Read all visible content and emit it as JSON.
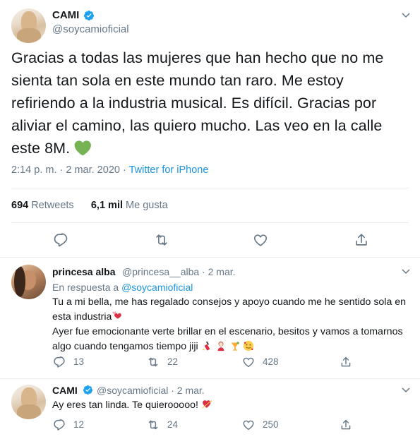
{
  "main_tweet": {
    "name": "CAMI",
    "handle": "@soycamioficial",
    "text": "Gracias a todas las mujeres que han hecho que no me sienta tan sola en este mundo tan raro. Me estoy refiriendo a la industria musical. Es difícil. Gracias por aliviar el camino, las quiero mucho. Las veo en la calle este 8M.",
    "timestamp": "2:14 p. m. · 2 mar. 2020 ·",
    "source": "Twitter for iPhone",
    "retweets_count": "694",
    "retweets_label": "Retweets",
    "likes_count": "6,1 mil",
    "likes_label": "Me gusta",
    "text_emoji": "green-heart-icon"
  },
  "replies": [
    {
      "name": "princesa alba",
      "handle_date": "@princesa__alba · 2 mar.",
      "in_reply_prefix": "En respuesta a",
      "in_reply_mention": "@soycamioficial",
      "line1": "Tu a mi bella, me has regalado consejos y apoyo cuando me he sentido sola en esta industria",
      "line2": "Ayer fue emocionante verte brillar en el escenario, besitos y vamos a tomarnos algo cuando tengamos tiempo jiji",
      "replies_count": "13",
      "retweets_count": "22",
      "likes_count": "428"
    },
    {
      "name": "CAMI",
      "handle_date": "@soycamioficial · 2 mar.",
      "text": "Ay eres tan linda. Te quierooooo!",
      "replies_count": "12",
      "retweets_count": "24",
      "likes_count": "250"
    }
  ],
  "colors": {
    "verified": "#1da1f2",
    "link": "#1b95e0",
    "secondary_text": "#657786",
    "icon": "#657786",
    "divider": "#e6ecf0",
    "green_heart": "#77b255"
  }
}
